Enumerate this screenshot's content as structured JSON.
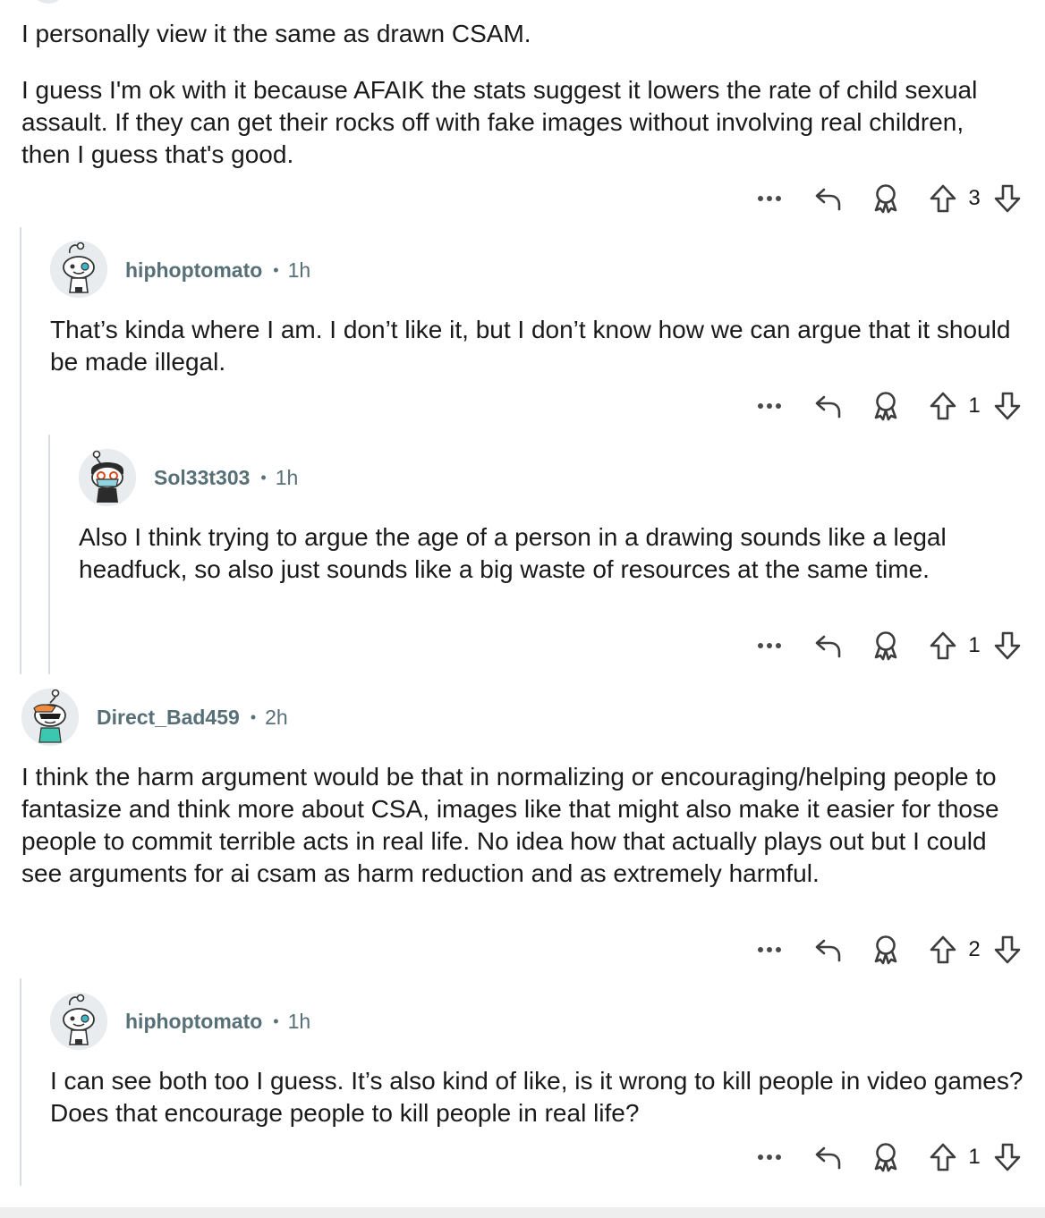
{
  "comments": [
    {
      "paragraphs": [
        "I personally view it the same as drawn CSAM.",
        "I guess I'm ok with it because AFAIK the stats suggest it lowers the rate of child sexual assault. If they can get their rocks off with fake images without involving real children, then I guess that's good."
      ],
      "score": "3"
    },
    {
      "username": "hiphoptomato",
      "separator": "•",
      "time": "1h",
      "text": "That’s kinda where I am. I don’t like it, but I don’t know how we can argue that it should be made illegal.",
      "score": "1"
    },
    {
      "username": "Sol33t303",
      "separator": "•",
      "time": "1h",
      "text": "Also I think trying to argue the age of a person in a drawing sounds like a legal headfuck, so also just sounds like a big waste of resources at the same time.",
      "score": "1"
    },
    {
      "username": "Direct_Bad459",
      "separator": "•",
      "time": "2h",
      "text": "I think the harm argument would be that in normalizing or encouraging/helping people to fantasize and think more about CSA, images like that might also make it easier for those people to commit terrible acts in real life. No idea how that actually plays out but I could see arguments for ai csam as harm reduction and as extremely harmful.",
      "score": "2"
    },
    {
      "username": "hiphoptomato",
      "separator": "•",
      "time": "1h",
      "text": "I can see both too I guess. It’s also kind of like, is it wrong to kill people in video games? Does that encourage people to kill people in real life?",
      "score": "1"
    }
  ],
  "icons": {
    "more": "more-options-icon",
    "reply": "reply-icon",
    "award": "award-icon",
    "upvote": "upvote-arrow-icon",
    "downvote": "downvote-arrow-icon"
  },
  "colors": {
    "meta": "#576f76",
    "text": "#1a1a1b",
    "thread_line": "#d9dde0"
  }
}
